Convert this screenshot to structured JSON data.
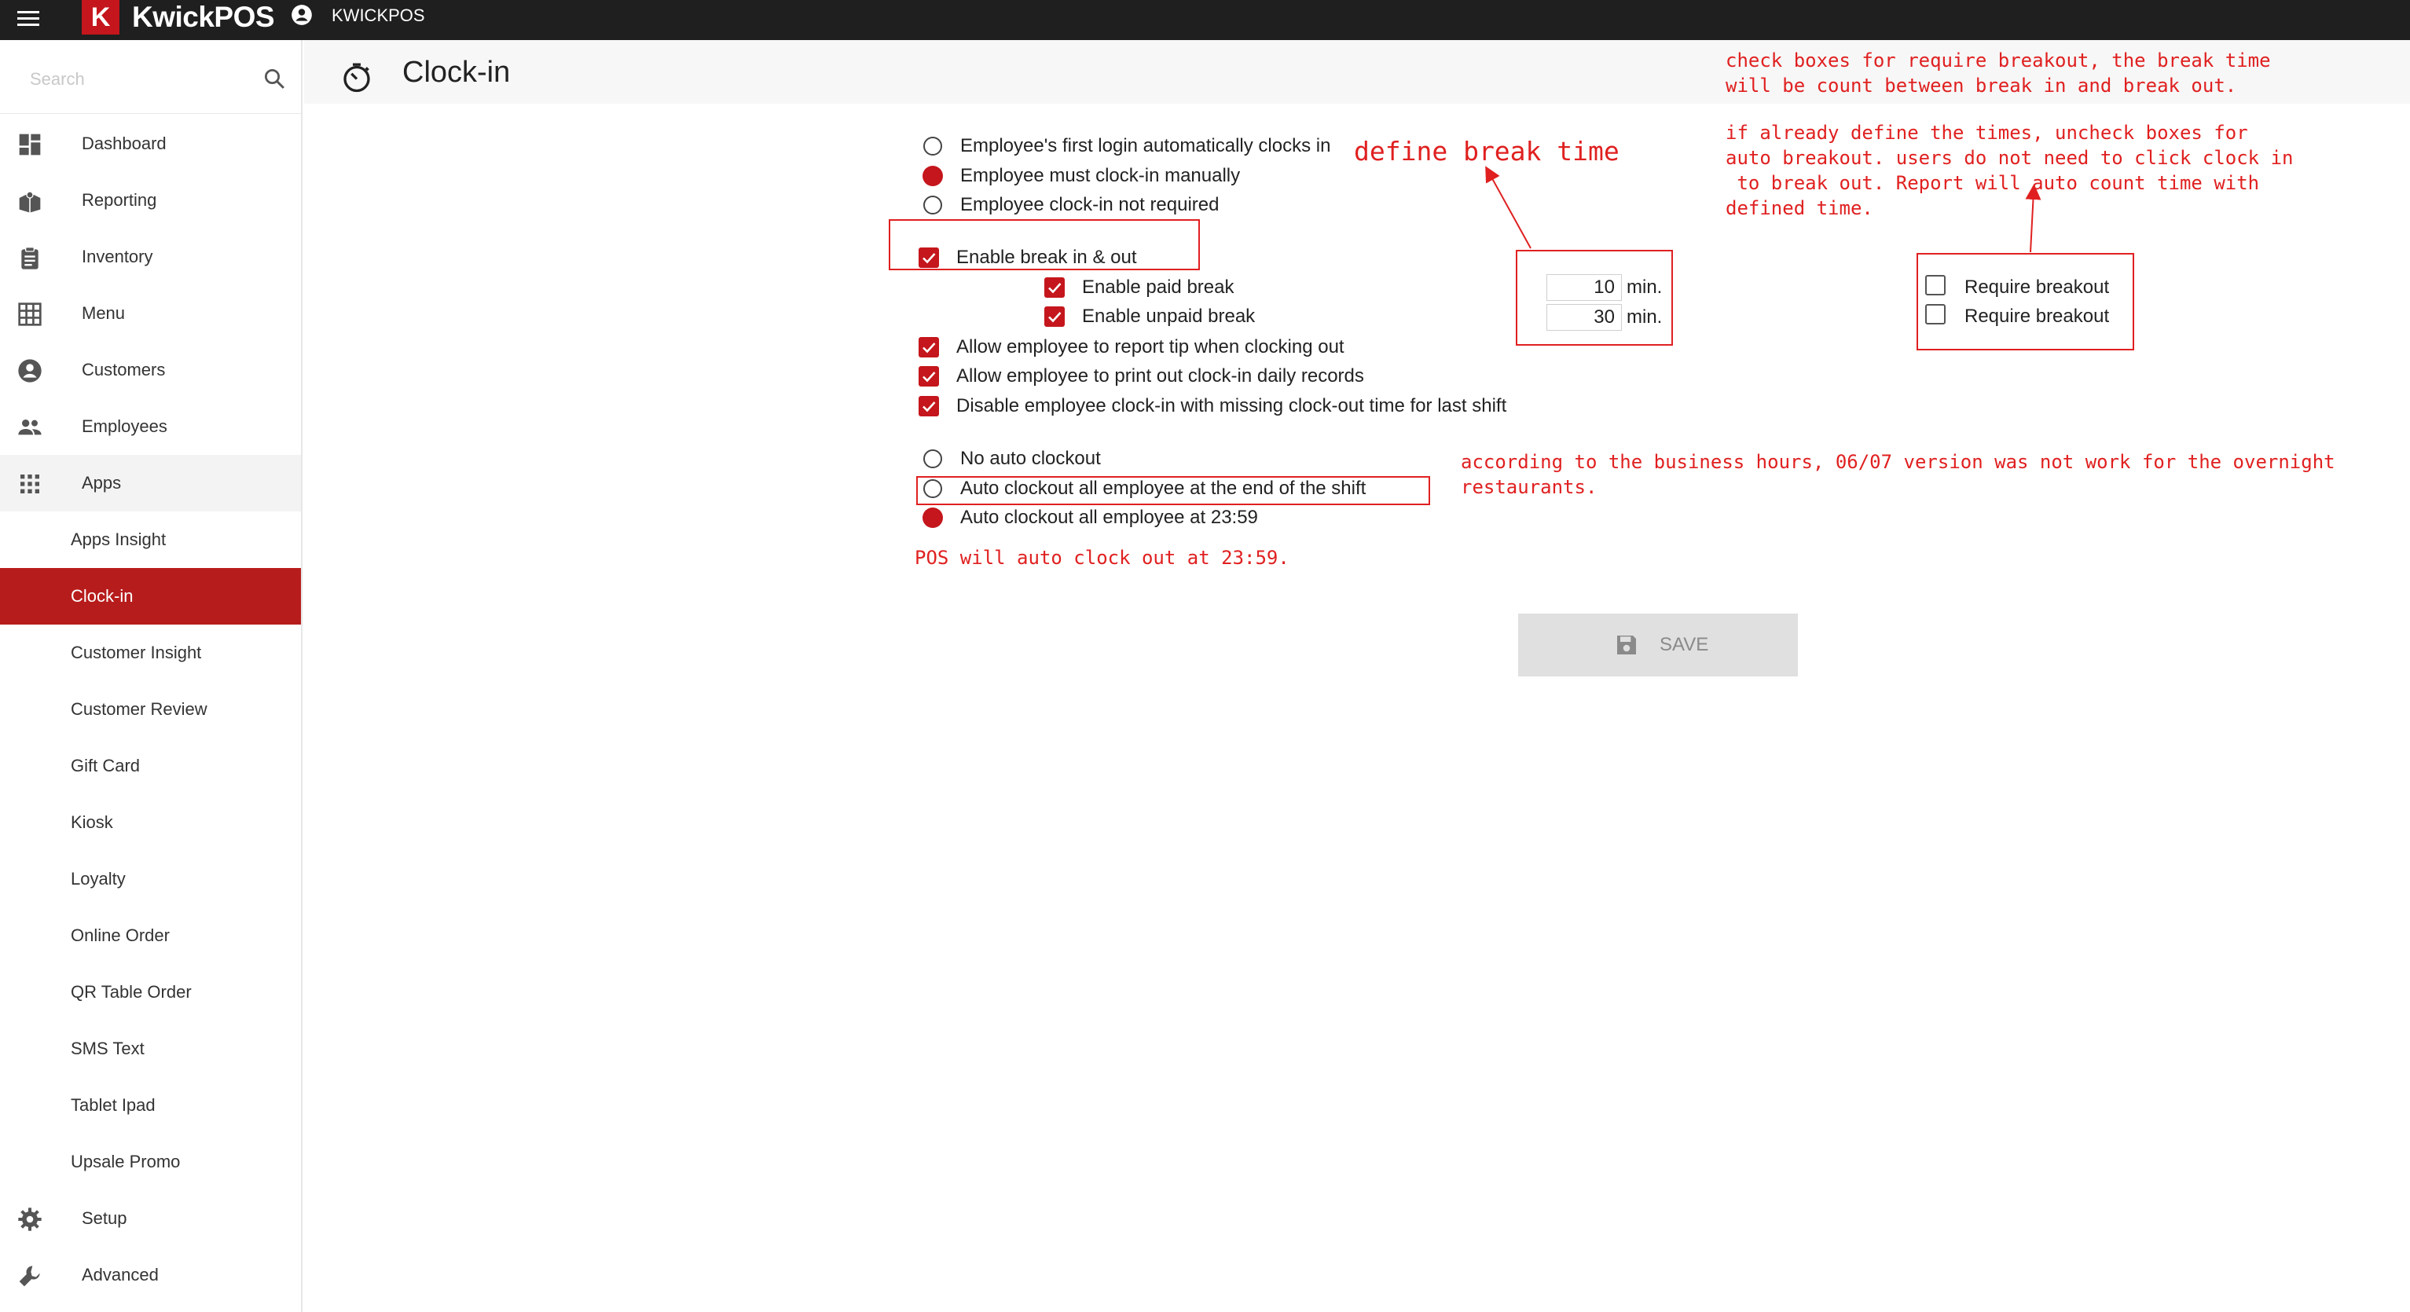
{
  "topbar": {
    "logo_letter": "K",
    "app_name": "KwickPOS",
    "user_name": "KWICKPOS"
  },
  "sidebar": {
    "search_placeholder": "Search",
    "items": [
      {
        "label": "Dashboard",
        "icon": "dashboard-icon"
      },
      {
        "label": "Reporting",
        "icon": "reporting-icon"
      },
      {
        "label": "Inventory",
        "icon": "clipboard-icon"
      },
      {
        "label": "Menu",
        "icon": "grid-icon"
      },
      {
        "label": "Customers",
        "icon": "person-circle-icon"
      },
      {
        "label": "Employees",
        "icon": "people-icon"
      },
      {
        "label": "Apps",
        "icon": "apps-icon"
      }
    ],
    "apps_sub": [
      "Apps Insight",
      "Clock-in",
      "Customer Insight",
      "Customer Review",
      "Gift Card",
      "Kiosk",
      "Loyalty",
      "Online Order",
      "QR Table Order",
      "SMS Text",
      "Tablet Ipad",
      "Upsale Promo"
    ],
    "active_sub": "Clock-in",
    "bottom_items": [
      {
        "label": "Setup",
        "icon": "gear-icon"
      },
      {
        "label": "Advanced",
        "icon": "wrench-icon"
      }
    ]
  },
  "header": {
    "title": "Clock-in"
  },
  "form": {
    "login_options": [
      {
        "label": "Employee's first login automatically clocks in",
        "selected": false
      },
      {
        "label": "Employee must clock-in manually",
        "selected": true
      },
      {
        "label": "Employee clock-in not required",
        "selected": false
      }
    ],
    "enable_break": {
      "label": "Enable break in & out",
      "checked": true
    },
    "paid_break": {
      "label": "Enable paid break",
      "checked": true,
      "minutes": "10",
      "unit": "min.",
      "require_label": "Require breakout",
      "require_checked": false
    },
    "unpaid_break": {
      "label": "Enable unpaid break",
      "checked": true,
      "minutes": "30",
      "unit": "min.",
      "require_label": "Require breakout",
      "require_checked": false
    },
    "allow_tip": {
      "label": "Allow employee to report tip when clocking out",
      "checked": true
    },
    "allow_print": {
      "label": "Allow employee to print out clock-in daily records",
      "checked": true
    },
    "disable_missing": {
      "label": "Disable employee clock-in with missing clock-out time for last shift",
      "checked": true
    },
    "auto_clockout_options": [
      {
        "label": "No auto clockout",
        "selected": false
      },
      {
        "label": "Auto clockout all employee at the end of the shift",
        "selected": false
      },
      {
        "label": "Auto clockout all employee at 23:59",
        "selected": true
      }
    ],
    "save_label": "SAVE"
  },
  "annotations": {
    "define_break": "define break time",
    "require_note": "check boxes for require breakout, the break time\nwill be count between break in and break out.",
    "auto_note": "if already define the times, uncheck boxes for\nauto breakout. users do not need to click clock in\n to break out. Report will auto count time with\ndefined time.",
    "shift_note": "according to the business hours, 06/07 version was not work for the overnight\nrestaurants.",
    "pos_note": "POS will auto clock out at 23:59."
  },
  "colors": {
    "brand": "#c4161c",
    "active_nav": "#b71c1c",
    "annotation": "#e02020",
    "topbar": "#1f1f1f"
  }
}
